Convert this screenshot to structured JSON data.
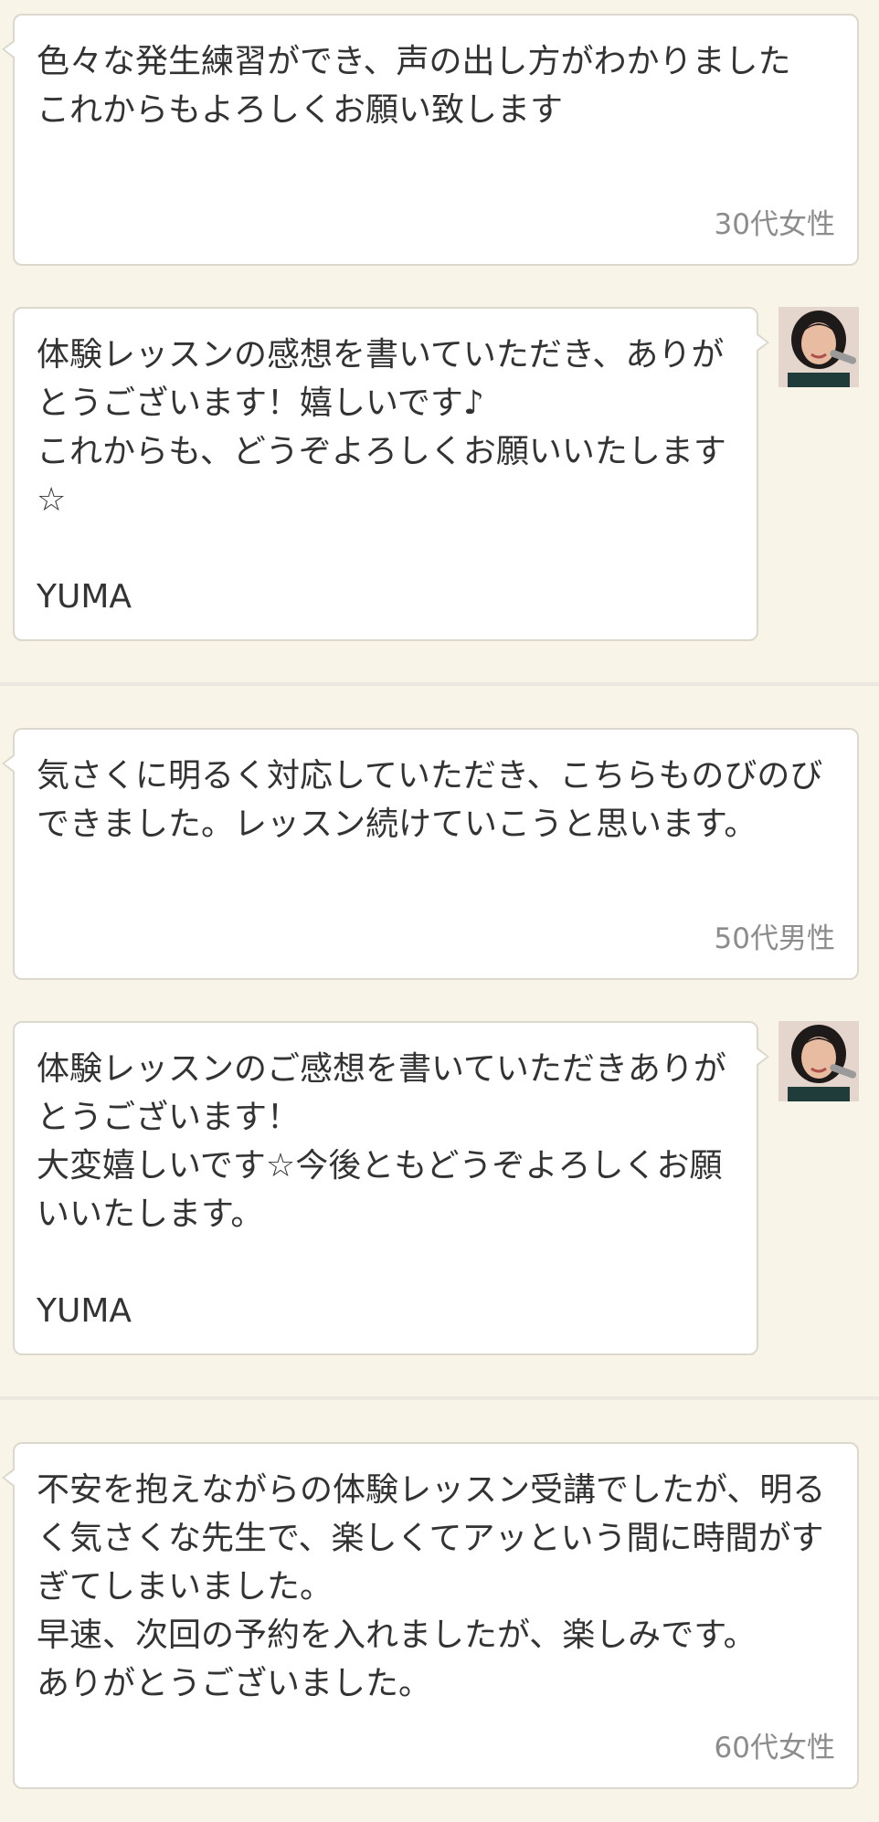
{
  "reviews": [
    {
      "comment": "色々な発生練習ができ、声の出し方がわかりました\nこれからもよろしくお願い致します",
      "author": "30代女性",
      "reply": "体験レッスンの感想を書いていただき、ありがとうございます！嬉しいです♪\nこれからも、どうぞよろしくお願いいたします☆\n\nYUMA"
    },
    {
      "comment": "気さくに明るく対応していただき、こちらものびのびできました。レッスン続けていこうと思います。",
      "author": "50代男性",
      "reply": "体験レッスンのご感想を書いていただきありがとうございます！\n大変嬉しいです☆今後ともどうぞよろしくお願いいたします。\n\nYUMA"
    },
    {
      "comment": "不安を抱えながらの体験レッスン受講でしたが、明るく気さくな先生で、楽しくてアッという間に時間がすぎてしまいました。\n早速、次回の予約を入れましたが、楽しみです。\nありがとうございました。",
      "author": "60代女性"
    }
  ]
}
